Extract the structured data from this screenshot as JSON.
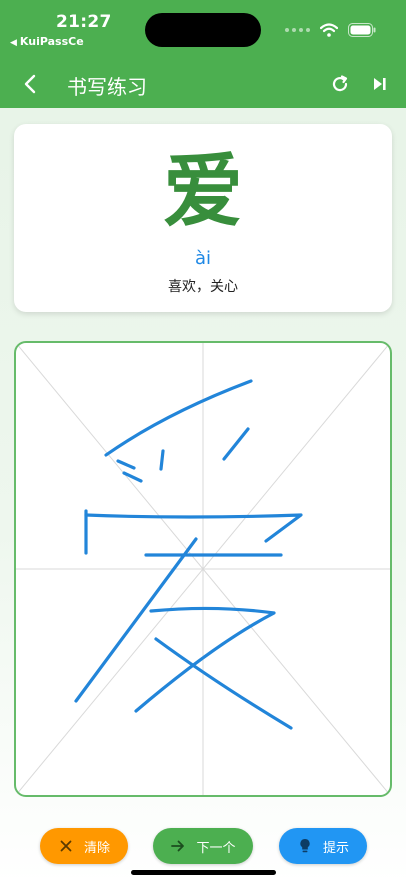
{
  "status_bar": {
    "time": "21:27",
    "back_app": "KuiPassCe"
  },
  "toolbar": {
    "title": "书写练习"
  },
  "card": {
    "character": "爱",
    "pinyin": "ài",
    "meaning": "喜欢，关心"
  },
  "buttons": {
    "clear_label": "清除",
    "next_label": "下一个",
    "hint_label": "提示"
  },
  "colors": {
    "primary": "#4caf50",
    "character": "#388e3c",
    "pinyin": "#1e88e5",
    "stroke": "#2285d9",
    "clear": "#ff9800",
    "next": "#4caf50",
    "hint": "#2196f3"
  },
  "icons": {
    "back": "chevron-left-icon",
    "refresh": "refresh-icon",
    "skip": "skip-next-icon",
    "clear": "close-icon",
    "next": "arrow-right-icon",
    "hint": "lightbulb-icon"
  }
}
